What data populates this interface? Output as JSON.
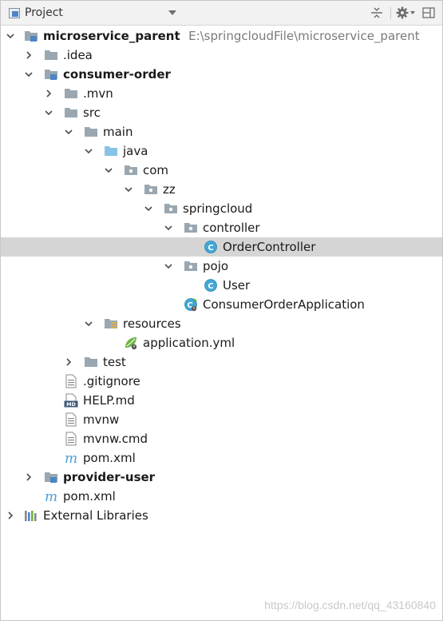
{
  "toolbar": {
    "title": "Project",
    "icons": [
      "project-view-icon",
      "dropdown-caret-icon",
      "collapse-all-icon",
      "settings-gear-icon",
      "hide-panel-icon"
    ]
  },
  "tree": {
    "root_label": "microservice_parent",
    "root_path": "E:\\springcloudFile\\microservice_parent",
    "idea": ".idea",
    "consumer_order": "consumer-order",
    "mvn": ".mvn",
    "src": "src",
    "main": "main",
    "java": "java",
    "com": "com",
    "zz": "zz",
    "springcloud": "springcloud",
    "controller": "controller",
    "order_controller": "OrderController",
    "pojo": "pojo",
    "user": "User",
    "consumer_app": "ConsumerOrderApplication",
    "resources": "resources",
    "application_yml": "application.yml",
    "test": "test",
    "gitignore": ".gitignore",
    "help_md": "HELP.md",
    "mvnw": "mvnw",
    "mvnw_cmd": "mvnw.cmd",
    "pom_inner": "pom.xml",
    "provider_user": "provider-user",
    "pom_root": "pom.xml",
    "external_libraries": "External Libraries"
  },
  "watermark": "https://blog.csdn.net/qq_43160840",
  "colors": {
    "selected_row": "#d5d5d5",
    "folder_gray": "#9aa7b0",
    "source_folder_blue": "#87c3e8",
    "module_blue": "#4d85c5",
    "class_badge": "#40a8d8",
    "maven_blue": "#4a9fd6",
    "spring_green": "#6db33f"
  }
}
